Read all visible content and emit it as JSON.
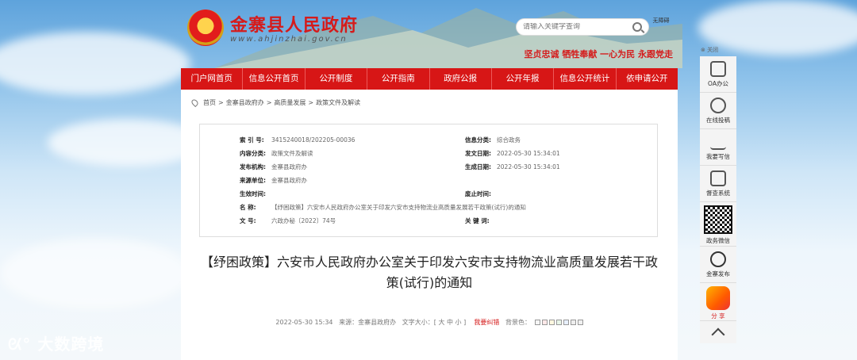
{
  "header": {
    "site_title": "金寨县人民政府",
    "site_url": "www.ahjinzhai.gov.cn",
    "search_placeholder": "请输入关键字查询",
    "accessibility": "无障碍",
    "slogan": "坚贞忠诚  牺牲奉献  一心为民  永跟党走"
  },
  "nav": [
    "门户网首页",
    "信息公开首页",
    "公开制度",
    "公开指南",
    "政府公报",
    "公开年报",
    "信息公开统计",
    "依申请公开"
  ],
  "breadcrumb": [
    "首页",
    ">",
    "金寨县政府办",
    ">",
    "高质量发展",
    ">",
    "政策文件及解读"
  ],
  "meta": {
    "index_label": "索 引 号:",
    "index_value": "3415240018/202205-00036",
    "category_label": "信息分类:",
    "category_value": "综合政务",
    "content_label": "内容分类:",
    "content_value": "政策文件及解读",
    "date_label": "发文日期:",
    "date_value": "2022-05-30 15:34:01",
    "org_label": "发布机构:",
    "org_value": "金寨县政府办",
    "gen_label": "生成日期:",
    "gen_value": "2022-05-30 15:34:01",
    "source_label": "来源单位:",
    "source_value": "金寨县政府办",
    "effective_label": "生效时间:",
    "expire_label": "废止时间:",
    "name_label": "名    称:",
    "name_value": "【纾困政策】六安市人民政府办公室关于印发六安市支持物流业高质量发展若干政策(试行)的通知",
    "docno_label": "文    号:",
    "docno_value": "六政办秘〔2022〕74号",
    "keyword_label": "关 键 词:"
  },
  "article": {
    "title": "【纾困政策】六安市人民政府办公室关于印发六安市支持物流业高质量发展若干政策(试行)的通知",
    "date": "2022-05-30 15:34",
    "source": "来源：金寨县政府办",
    "fontsize_label": "文字大小：[ 大 中 小 ]",
    "correction": "我要纠错",
    "bg_label": "背景色："
  },
  "sidebar": {
    "close": "关闭",
    "items": [
      "OA办公",
      "在线投稿",
      "我要写信",
      "督查系统"
    ],
    "wechat": "政务微信",
    "weibo": "金寨发布",
    "share": "分 享"
  },
  "watermark": "大数跨境",
  "colors": {
    "brand_red": "#d71616",
    "bg_swatches": [
      "#f5f5f5",
      "#ffe8e8",
      "#fff8e0",
      "#e8f5e8",
      "#e8f0ff",
      "#eeeeee",
      "#f0f0f0"
    ]
  }
}
